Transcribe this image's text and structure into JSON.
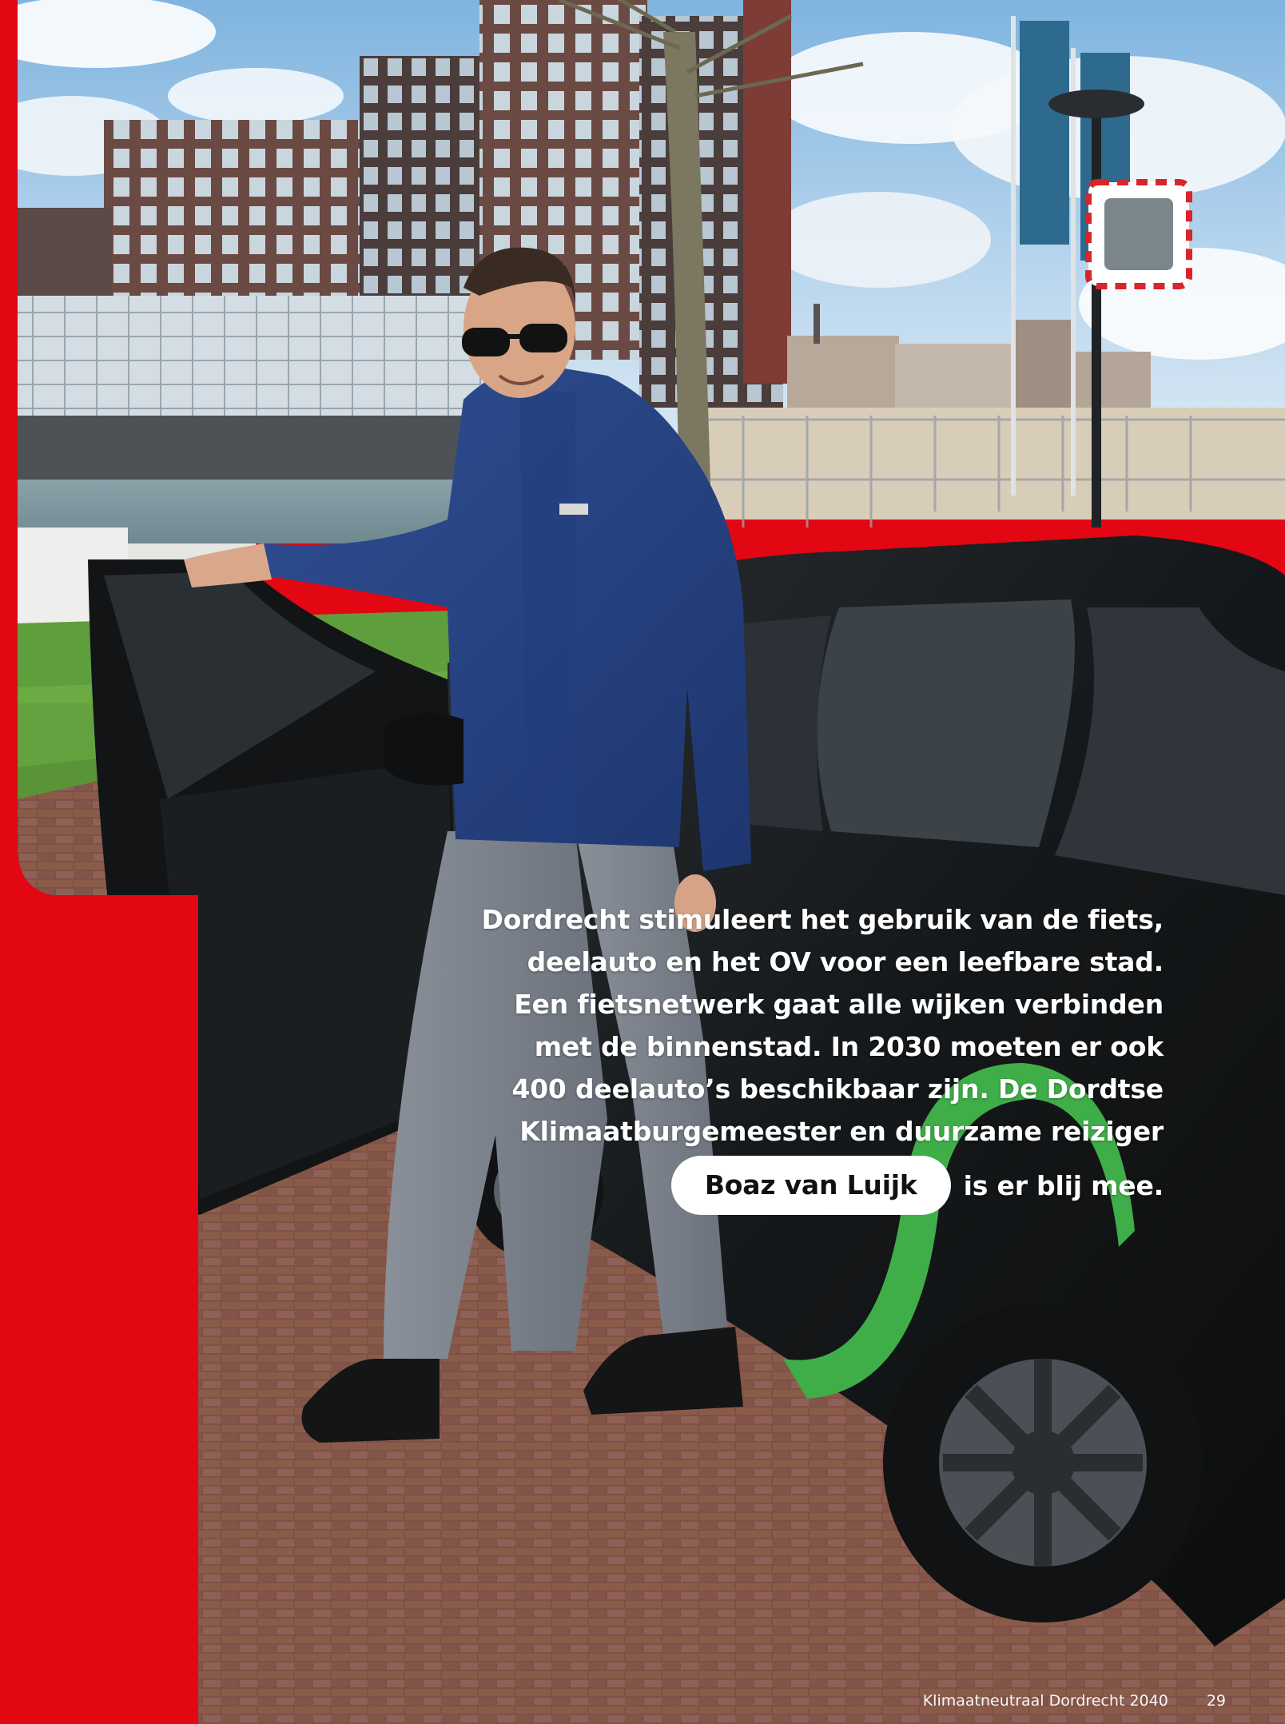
{
  "caption": {
    "lines": [
      "Dordrecht stimuleert het gebruik van de fiets,",
      "deelauto en het OV voor een leefbare stad.",
      "Een fietsnetwerk gaat alle wijken verbinden",
      "met de binnenstad. In 2030 moeten er ook",
      "400 deelauto’s beschikbaar zijn. De Dordtse",
      "Klimaatburgemeester en duurzame reiziger"
    ],
    "name": "Boaz van Luijk",
    "tail": "is er blij mee."
  },
  "footer": {
    "publication": "Klimaatneutraal Dordrecht 2040",
    "page_number": "29"
  },
  "colors": {
    "accent_red": "#e30613",
    "pill_bg": "#ffffff",
    "text_white": "#ffffff"
  }
}
